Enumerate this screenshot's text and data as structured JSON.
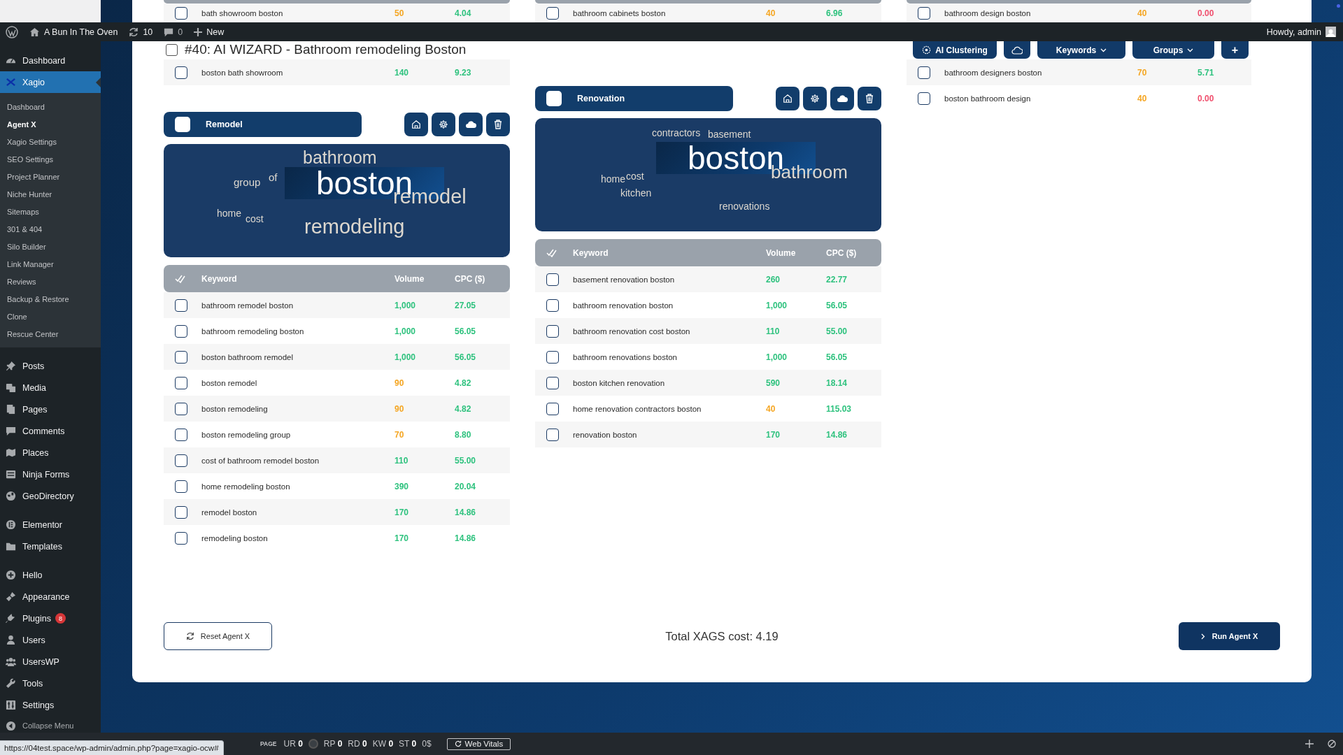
{
  "admin_bar": {
    "site": "A Bun In The Oven",
    "updates": "10",
    "comments": "0",
    "new": "New",
    "greeting": "Howdy, admin"
  },
  "sidebar": {
    "groups": [
      {
        "items": [
          {
            "label": "Dashboard",
            "selected": false
          },
          {
            "label": "Xagio",
            "selected": true,
            "children": [
              {
                "label": "Dashboard",
                "selected": false
              },
              {
                "label": "Agent X",
                "selected": true
              },
              {
                "label": "Xagio Settings",
                "selected": false
              },
              {
                "label": "SEO Settings",
                "selected": false
              },
              {
                "label": "Project Planner",
                "selected": false
              },
              {
                "label": "Niche Hunter",
                "selected": false
              },
              {
                "label": "Sitemaps",
                "selected": false
              },
              {
                "label": "301 & 404",
                "selected": false
              },
              {
                "label": "Silo Builder",
                "selected": false
              },
              {
                "label": "Link Manager",
                "selected": false
              },
              {
                "label": "Reviews",
                "selected": false
              },
              {
                "label": "Backup & Restore",
                "selected": false
              },
              {
                "label": "Clone",
                "selected": false
              },
              {
                "label": "Rescue Center",
                "selected": false
              }
            ]
          }
        ]
      },
      {
        "items": [
          {
            "label": "Posts",
            "selected": false
          },
          {
            "label": "Media",
            "selected": false
          },
          {
            "label": "Pages",
            "selected": false
          },
          {
            "label": "Comments",
            "selected": false
          },
          {
            "label": "Places",
            "selected": false
          },
          {
            "label": "Ninja Forms",
            "selected": false
          },
          {
            "label": "GeoDirectory",
            "selected": false
          }
        ]
      },
      {
        "items": [
          {
            "label": "Elementor",
            "selected": false
          },
          {
            "label": "Templates",
            "selected": false
          }
        ]
      },
      {
        "items": [
          {
            "label": "Hello",
            "selected": false
          },
          {
            "label": "Appearance",
            "selected": false
          },
          {
            "label": "Plugins",
            "selected": false,
            "badge": "8"
          },
          {
            "label": "Users",
            "selected": false
          },
          {
            "label": "UsersWP",
            "selected": false
          },
          {
            "label": "Tools",
            "selected": false
          },
          {
            "label": "Settings",
            "selected": false
          }
        ]
      }
    ],
    "collapse": "Collapse Menu"
  },
  "header": {
    "title": "#40: AI WIZARD - Bathroom remodeling Boston",
    "checked": false
  },
  "toolbar": [
    {
      "kind": "ai",
      "label": "AI Clustering"
    },
    {
      "kind": "cloud"
    },
    {
      "kind": "dropdown",
      "label": "Keywords"
    },
    {
      "kind": "dropdown",
      "label": "Groups"
    },
    {
      "kind": "text",
      "label": "+"
    }
  ],
  "columns": [
    {
      "cut_rows": [
        {
          "checked": false,
          "keyword": "bath showroom boston",
          "volume": {
            "text": "50",
            "color": "#f5a623"
          },
          "cpc": {
            "text": "4.04",
            "color": "#2ec27e"
          }
        }
      ],
      "rows": [
        {
          "checked": false,
          "keyword": "boston bath showroom",
          "volume": {
            "text": "140",
            "color": "#2ec27e"
          },
          "cpc": {
            "text": "9.23",
            "color": "#2ec27e"
          }
        }
      ],
      "card": {
        "title": "Remodel",
        "checked": false,
        "cloud": [
          "bathroom",
          "group",
          "of",
          "boston",
          "remodel",
          "home",
          "cost",
          "remodeling"
        ],
        "table_columns": [
          "Keyword",
          "Volume",
          "CPC ($)"
        ],
        "rows": [
          {
            "checked": false,
            "keyword": "bathroom remodel boston",
            "volume": {
              "text": "1,000",
              "color": "#2ec27e"
            },
            "cpc": {
              "text": "27.05",
              "color": "#2ec27e"
            }
          },
          {
            "checked": false,
            "keyword": "bathroom remodeling boston",
            "volume": {
              "text": "1,000",
              "color": "#2ec27e"
            },
            "cpc": {
              "text": "56.05",
              "color": "#2ec27e"
            }
          },
          {
            "checked": false,
            "keyword": "boston bathroom remodel",
            "volume": {
              "text": "1,000",
              "color": "#2ec27e"
            },
            "cpc": {
              "text": "56.05",
              "color": "#2ec27e"
            }
          },
          {
            "checked": false,
            "keyword": "boston remodel",
            "volume": {
              "text": "90",
              "color": "#f5a623"
            },
            "cpc": {
              "text": "4.82",
              "color": "#2ec27e"
            }
          },
          {
            "checked": false,
            "keyword": "boston remodeling",
            "volume": {
              "text": "90",
              "color": "#f5a623"
            },
            "cpc": {
              "text": "4.82",
              "color": "#2ec27e"
            }
          },
          {
            "checked": false,
            "keyword": "boston remodeling group",
            "volume": {
              "text": "70",
              "color": "#f5a623"
            },
            "cpc": {
              "text": "8.80",
              "color": "#2ec27e"
            }
          },
          {
            "checked": false,
            "keyword": "cost of bathroom remodel boston",
            "volume": {
              "text": "110",
              "color": "#2ec27e"
            },
            "cpc": {
              "text": "55.00",
              "color": "#2ec27e"
            }
          },
          {
            "checked": false,
            "keyword": "home remodeling boston",
            "volume": {
              "text": "390",
              "color": "#2ec27e"
            },
            "cpc": {
              "text": "20.04",
              "color": "#2ec27e"
            }
          },
          {
            "checked": false,
            "keyword": "remodel boston",
            "volume": {
              "text": "170",
              "color": "#2ec27e"
            },
            "cpc": {
              "text": "14.86",
              "color": "#2ec27e"
            }
          },
          {
            "checked": false,
            "keyword": "remodeling boston",
            "volume": {
              "text": "170",
              "color": "#2ec27e"
            },
            "cpc": {
              "text": "14.86",
              "color": "#2ec27e"
            }
          }
        ]
      }
    },
    {
      "cut_rows": [
        {
          "checked": false,
          "keyword": "bathroom cabinets boston",
          "volume": {
            "text": "40",
            "color": "#f5a623"
          },
          "cpc": {
            "text": "6.96",
            "color": "#2ec27e"
          }
        }
      ],
      "card": {
        "title": "Renovation",
        "checked": false,
        "cloud": [
          "contractors",
          "basement",
          "boston",
          "bathroom",
          "home",
          "cost",
          "kitchen",
          "renovations"
        ],
        "table_columns": [
          "Keyword",
          "Volume",
          "CPC ($)"
        ],
        "rows": [
          {
            "checked": false,
            "keyword": "basement renovation boston",
            "volume": {
              "text": "260",
              "color": "#2ec27e"
            },
            "cpc": {
              "text": "22.77",
              "color": "#2ec27e"
            }
          },
          {
            "checked": false,
            "keyword": "bathroom renovation boston",
            "volume": {
              "text": "1,000",
              "color": "#2ec27e"
            },
            "cpc": {
              "text": "56.05",
              "color": "#2ec27e"
            }
          },
          {
            "checked": false,
            "keyword": "bathroom renovation cost boston",
            "volume": {
              "text": "110",
              "color": "#2ec27e"
            },
            "cpc": {
              "text": "55.00",
              "color": "#2ec27e"
            }
          },
          {
            "checked": false,
            "keyword": "bathroom renovations boston",
            "volume": {
              "text": "1,000",
              "color": "#2ec27e"
            },
            "cpc": {
              "text": "56.05",
              "color": "#2ec27e"
            }
          },
          {
            "checked": false,
            "keyword": "boston kitchen renovation",
            "volume": {
              "text": "590",
              "color": "#2ec27e"
            },
            "cpc": {
              "text": "18.14",
              "color": "#2ec27e"
            }
          },
          {
            "checked": false,
            "keyword": "home renovation contractors boston",
            "volume": {
              "text": "40",
              "color": "#f5a623"
            },
            "cpc": {
              "text": "115.03",
              "color": "#2ec27e"
            }
          },
          {
            "checked": false,
            "keyword": "renovation boston",
            "volume": {
              "text": "170",
              "color": "#2ec27e"
            },
            "cpc": {
              "text": "14.86",
              "color": "#2ec27e"
            }
          }
        ]
      }
    },
    {
      "cut_rows": [
        {
          "checked": false,
          "keyword": "bathroom design boston",
          "volume": {
            "text": "40",
            "color": "#f5a623"
          },
          "cpc": {
            "text": "0.00",
            "color": "#f0506e"
          }
        }
      ],
      "rows": [
        {
          "checked": false,
          "keyword": "bathroom designers boston",
          "volume": {
            "text": "70",
            "color": "#f5a623"
          },
          "cpc": {
            "text": "5.71",
            "color": "#2ec27e"
          }
        },
        {
          "checked": false,
          "keyword": "boston bathroom design",
          "volume": {
            "text": "40",
            "color": "#f5a623"
          },
          "cpc": {
            "text": "0.00",
            "color": "#f0506e"
          }
        }
      ]
    }
  ],
  "footer": {
    "reset": "Reset Agent X",
    "total": "Total XAGS cost: 4.19",
    "run": "Run Agent X"
  },
  "debug_bar": {
    "label": "PAGE",
    "metrics": [
      {
        "name": "UR",
        "value": "0"
      },
      {
        "name": "RP",
        "value": "0"
      },
      {
        "name": "RD",
        "value": "0"
      },
      {
        "name": "KW",
        "value": "0"
      },
      {
        "name": "ST",
        "value": "0"
      }
    ],
    "cost": "0$",
    "vitals": "Web Vitals",
    "status_url": "https://04test.space/wp-admin/admin.php?page=xagio-ocw#"
  }
}
